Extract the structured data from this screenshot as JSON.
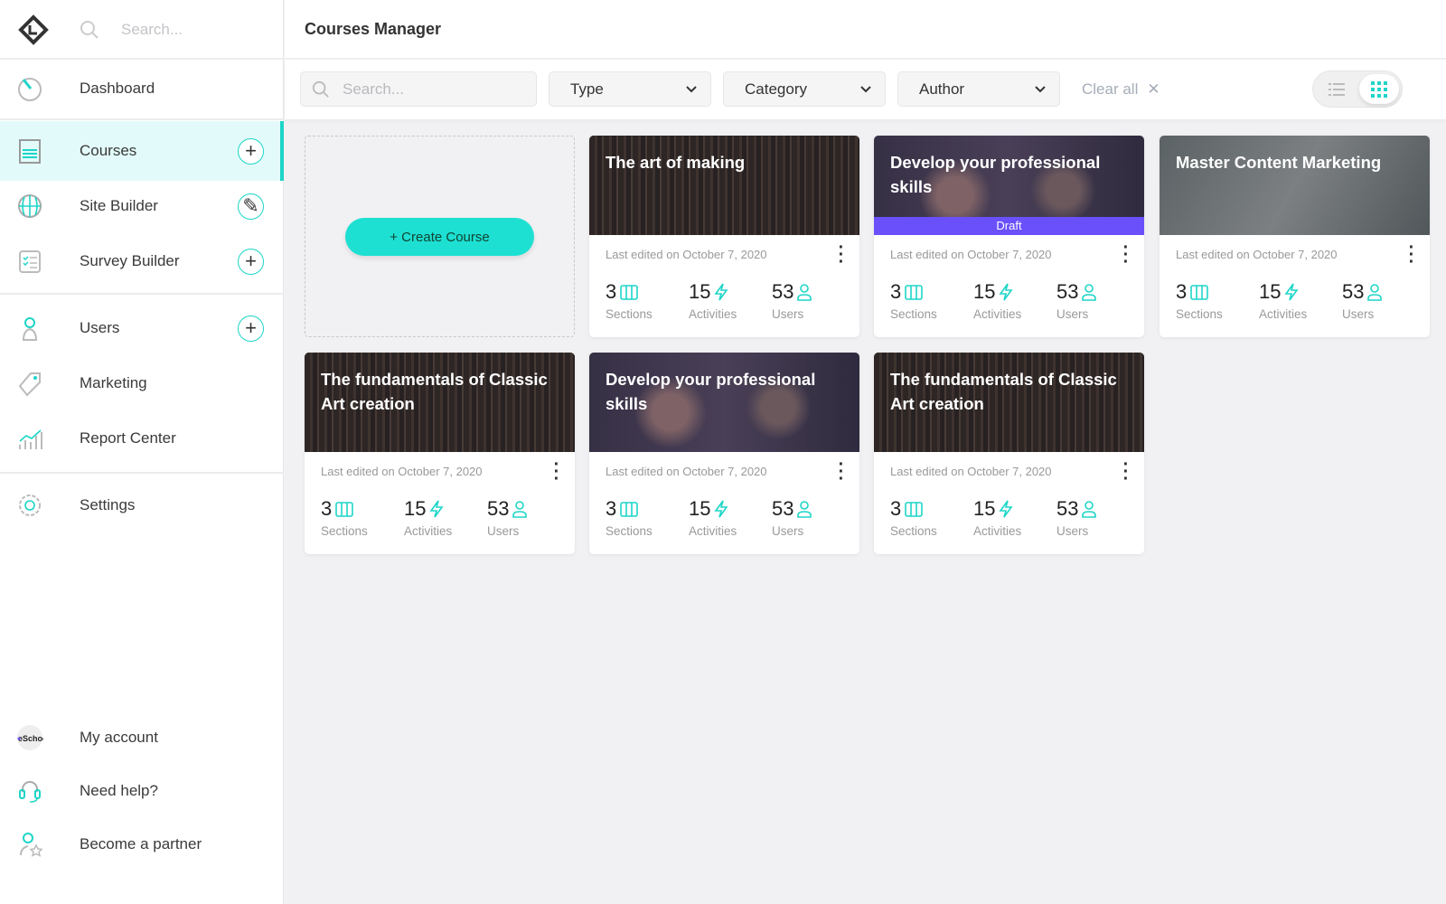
{
  "sidebar": {
    "search_placeholder": "Search...",
    "items": [
      {
        "label": "Dashboard",
        "icon": "dashboard-icon"
      },
      {
        "label": "Courses",
        "icon": "courses-icon",
        "action": "add",
        "active": true
      },
      {
        "label": "Site Builder",
        "icon": "globe-icon",
        "action": "edit"
      },
      {
        "label": "Survey Builder",
        "icon": "survey-icon",
        "action": "add"
      },
      {
        "label": "Users",
        "icon": "users-icon",
        "action": "add"
      },
      {
        "label": "Marketing",
        "icon": "tag-icon"
      },
      {
        "label": "Report Center",
        "icon": "chart-icon"
      },
      {
        "label": "Settings",
        "icon": "gear-icon"
      }
    ],
    "bottom": [
      {
        "label": "My account",
        "avatar_text": "eSchool"
      },
      {
        "label": "Need help?"
      },
      {
        "label": "Become a partner"
      }
    ]
  },
  "header": {
    "title": "Courses Manager"
  },
  "filters": {
    "search_placeholder": "Search...",
    "type": "Type",
    "category": "Category",
    "author": "Author",
    "clear_all": "Clear all"
  },
  "create_label": "+ Create Course",
  "accent": "#1dd5c8",
  "draft_color": "#6a50fb",
  "courses": [
    {
      "title": "The art of making",
      "image": "books",
      "date": "Last edited on October 7, 2020",
      "sections": "3",
      "activities": "15",
      "users": "53"
    },
    {
      "title": "Develop your professional skills",
      "image": "people",
      "draft": "Draft",
      "date": "Last edited on October 7, 2020",
      "sections": "3",
      "activities": "15",
      "users": "53"
    },
    {
      "title": "Master Content Marketing",
      "image": "office",
      "date": "Last edited on October 7, 2020",
      "sections": "3",
      "activities": "15",
      "users": "53"
    },
    {
      "title": "The fundamentals of Classic Art creation",
      "image": "books",
      "date": "Last edited on October 7, 2020",
      "sections": "3",
      "activities": "15",
      "users": "53"
    },
    {
      "title": "Develop your professional skills",
      "image": "people",
      "date": "Last edited on October 7, 2020",
      "sections": "3",
      "activities": "15",
      "users": "53"
    },
    {
      "title": "The fundamentals of Classic Art creation",
      "image": "books",
      "date": "Last edited on October 7, 2020",
      "sections": "3",
      "activities": "15",
      "users": "53"
    }
  ],
  "stat_labels": {
    "sections": "Sections",
    "activities": "Activities",
    "users": "Users"
  }
}
